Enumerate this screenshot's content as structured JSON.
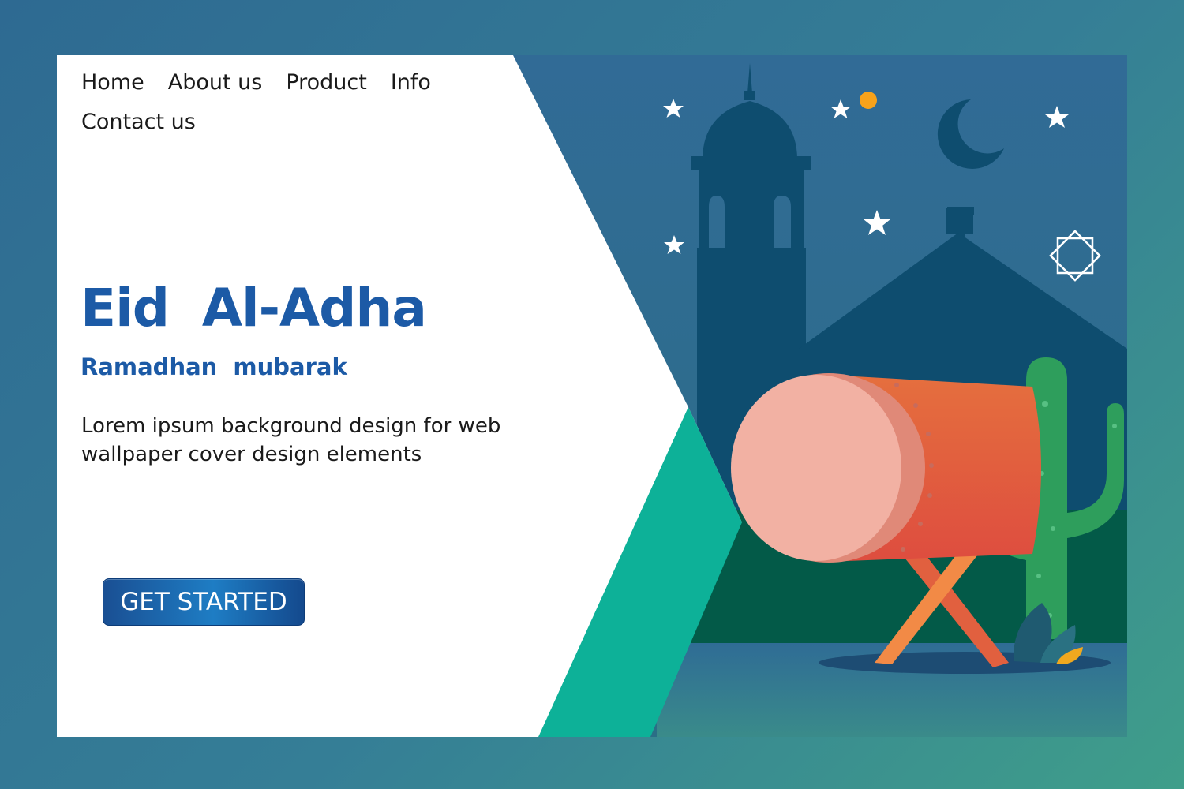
{
  "nav": {
    "items": [
      {
        "label": "Home"
      },
      {
        "label": "About us"
      },
      {
        "label": "Product"
      },
      {
        "label": "Info"
      },
      {
        "label": "Contact us"
      }
    ]
  },
  "hero": {
    "title": "Eid  Al-Adha",
    "subtitle": "Ramadhan  mubarak",
    "description": "Lorem ipsum background  design for web wallpaper cover design elements",
    "cta_label": "GET STARTED"
  },
  "colors": {
    "page_background": "#2e6a92",
    "night_sky": "#326b93",
    "title_blue": "#1c5aa6",
    "accent_teal": "#0db198",
    "drum_orange": "#e1603f",
    "cactus_green": "#2e9e5c"
  }
}
